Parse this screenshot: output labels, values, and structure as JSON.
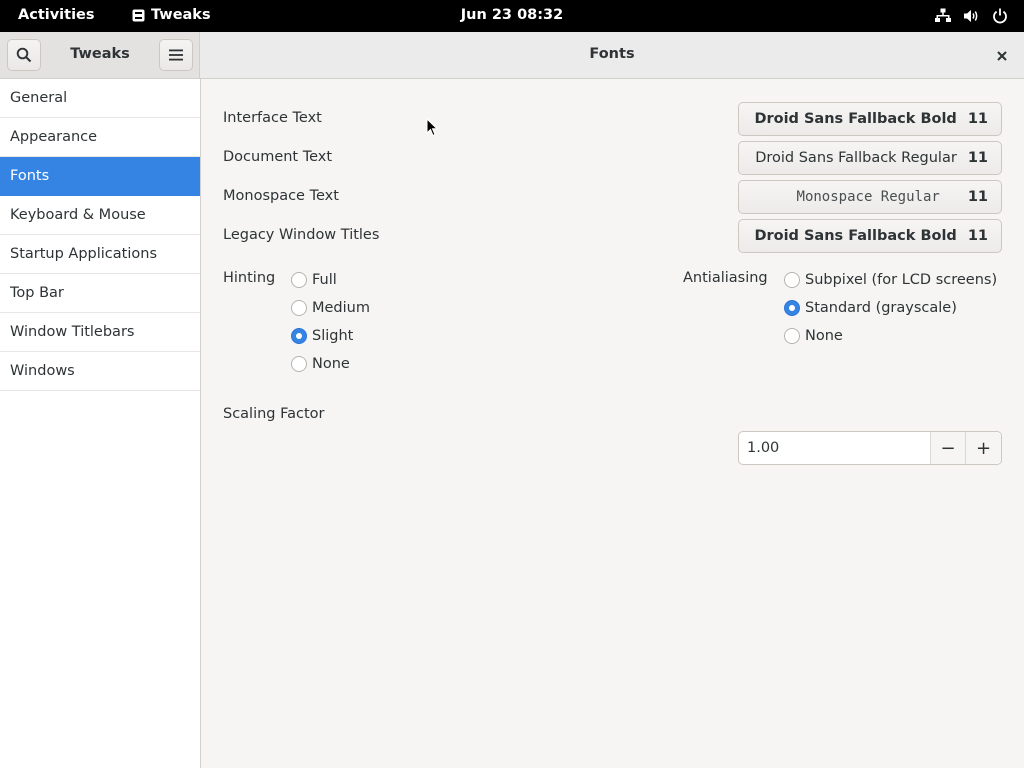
{
  "topbar": {
    "activities": "Activities",
    "app_name": "Tweaks",
    "clock": "Jun 23  08:32",
    "icons": [
      "network-icon",
      "volume-icon",
      "power-icon"
    ]
  },
  "header": {
    "sidebar_title": "Tweaks",
    "page_title": "Fonts"
  },
  "sidebar": {
    "items": [
      {
        "label": "General"
      },
      {
        "label": "Appearance"
      },
      {
        "label": "Fonts"
      },
      {
        "label": "Keyboard & Mouse"
      },
      {
        "label": "Startup Applications"
      },
      {
        "label": "Top Bar"
      },
      {
        "label": "Window Titlebars"
      },
      {
        "label": "Windows"
      }
    ],
    "selected": "Fonts"
  },
  "fonts": {
    "interface": {
      "label": "Interface Text",
      "font": "Droid Sans Fallback Bold",
      "size": "11"
    },
    "document": {
      "label": "Document Text",
      "font": "Droid Sans Fallback Regular",
      "size": "11"
    },
    "monospace": {
      "label": "Monospace Text",
      "font": "Monospace Regular",
      "size": "11"
    },
    "legacy": {
      "label": "Legacy Window Titles",
      "font": "Droid Sans Fallback Bold",
      "size": "11"
    }
  },
  "hinting": {
    "label": "Hinting",
    "options": [
      "Full",
      "Medium",
      "Slight",
      "None"
    ],
    "selected": "Slight"
  },
  "antialiasing": {
    "label": "Antialiasing",
    "options": [
      "Subpixel (for LCD screens)",
      "Standard (grayscale)",
      "None"
    ],
    "selected": "Standard (grayscale)"
  },
  "scaling": {
    "label": "Scaling Factor",
    "value": "1.00",
    "minus": "−",
    "plus": "+"
  },
  "colors": {
    "accent": "#3584e4",
    "topbar": "#000000"
  }
}
